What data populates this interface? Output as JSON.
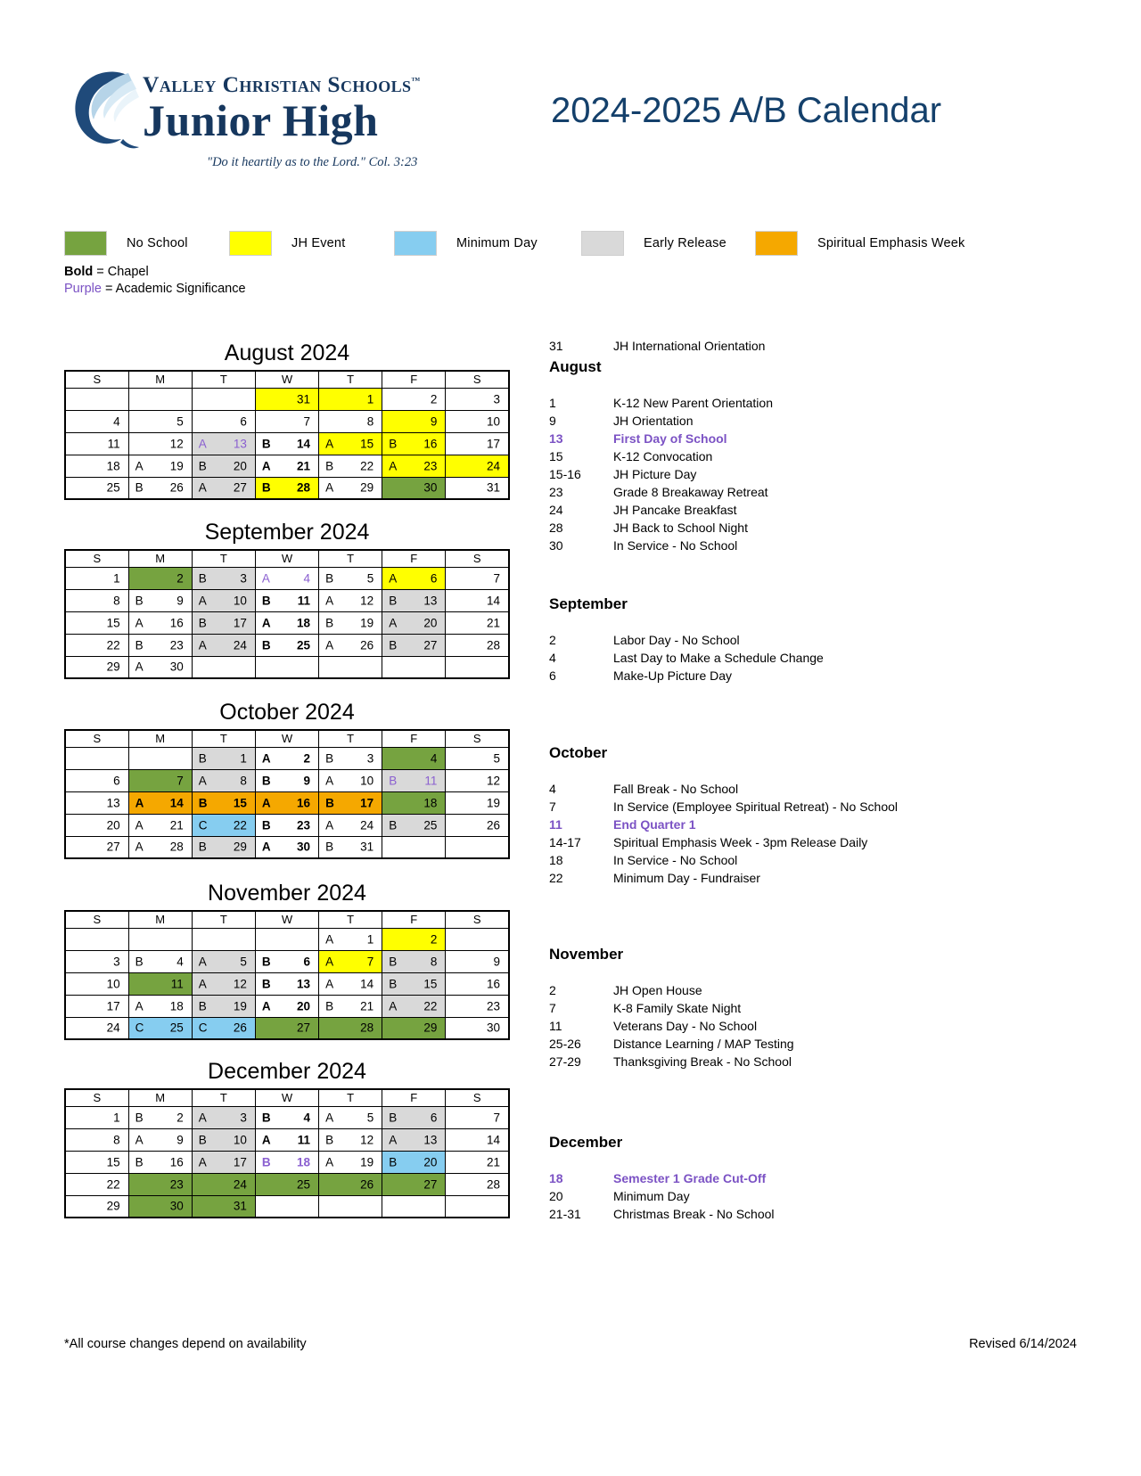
{
  "header": {
    "logo_line1": "Valley Christian Schools",
    "logo_tm": "™",
    "logo_line2": "Junior High",
    "tagline": "\"Do it heartily as to the Lord.\"  Col. 3:23",
    "title": "2024-2025 A/B Calendar"
  },
  "legend": {
    "items": [
      {
        "label": "No School",
        "color": "#76a340"
      },
      {
        "label": "JH Event",
        "color": "#ffff00"
      },
      {
        "label": "Minimum Day",
        "color": "#86cdf0"
      },
      {
        "label": "Early Release",
        "color": "#d9d9d9"
      },
      {
        "label": "Spiritual Emphasis Week",
        "color": "#f5a800"
      }
    ],
    "note_bold": "Bold",
    "note_bold_rest": " = Chapel",
    "note_purple": "Purple",
    "note_purple_rest": " = Academic Significance"
  },
  "weekday_headers": [
    "S",
    "M",
    "T",
    "W",
    "T",
    "F",
    "S"
  ],
  "months": [
    {
      "title": "August 2024",
      "weeks": [
        [
          {},
          {},
          {},
          {
            "num": "31",
            "fill": "jhevent"
          },
          {
            "num": "1",
            "fill": "jhevent"
          },
          {
            "num": "2"
          },
          {
            "num": "3"
          }
        ],
        [
          {
            "num": "4"
          },
          {
            "num": "5"
          },
          {
            "num": "6"
          },
          {
            "num": "7"
          },
          {
            "num": "8"
          },
          {
            "num": "9",
            "fill": "jhevent"
          },
          {
            "num": "10"
          }
        ],
        [
          {
            "num": "11"
          },
          {
            "num": "12"
          },
          {
            "ab": "A",
            "num": "13",
            "fill": "early",
            "acad": true
          },
          {
            "ab": "B",
            "num": "14",
            "chapel": true
          },
          {
            "ab": "A",
            "num": "15",
            "fill": "jhevent"
          },
          {
            "ab": "B",
            "num": "16",
            "fill": "jhevent"
          },
          {
            "num": "17"
          }
        ],
        [
          {
            "num": "18"
          },
          {
            "ab": "A",
            "num": "19"
          },
          {
            "ab": "B",
            "num": "20",
            "fill": "early"
          },
          {
            "ab": "A",
            "num": "21",
            "chapel": true
          },
          {
            "ab": "B",
            "num": "22"
          },
          {
            "ab": "A",
            "num": "23",
            "fill": "jhevent"
          },
          {
            "num": "24",
            "fill": "jhevent"
          }
        ],
        [
          {
            "num": "25"
          },
          {
            "ab": "B",
            "num": "26"
          },
          {
            "ab": "A",
            "num": "27",
            "fill": "early"
          },
          {
            "ab": "B",
            "num": "28",
            "fill": "jhevent",
            "chapel": true
          },
          {
            "ab": "A",
            "num": "29"
          },
          {
            "num": "30",
            "fill": "noschool"
          },
          {
            "num": "31"
          }
        ]
      ]
    },
    {
      "title": "September 2024",
      "weeks": [
        [
          {
            "num": "1"
          },
          {
            "num": "2",
            "fill": "noschool"
          },
          {
            "ab": "B",
            "num": "3",
            "fill": "early"
          },
          {
            "ab": "A",
            "num": "4",
            "acad": true
          },
          {
            "ab": "B",
            "num": "5"
          },
          {
            "ab": "A",
            "num": "6",
            "fill": "jhevent"
          },
          {
            "num": "7"
          }
        ],
        [
          {
            "num": "8"
          },
          {
            "ab": "B",
            "num": "9"
          },
          {
            "ab": "A",
            "num": "10",
            "fill": "early"
          },
          {
            "ab": "B",
            "num": "11",
            "chapel": true
          },
          {
            "ab": "A",
            "num": "12"
          },
          {
            "ab": "B",
            "num": "13",
            "fill": "early"
          },
          {
            "num": "14"
          }
        ],
        [
          {
            "num": "15"
          },
          {
            "ab": "A",
            "num": "16"
          },
          {
            "ab": "B",
            "num": "17",
            "fill": "early"
          },
          {
            "ab": "A",
            "num": "18",
            "chapel": true
          },
          {
            "ab": "B",
            "num": "19"
          },
          {
            "ab": "A",
            "num": "20",
            "fill": "early"
          },
          {
            "num": "21"
          }
        ],
        [
          {
            "num": "22"
          },
          {
            "ab": "B",
            "num": "23"
          },
          {
            "ab": "A",
            "num": "24",
            "fill": "early"
          },
          {
            "ab": "B",
            "num": "25",
            "chapel": true
          },
          {
            "ab": "A",
            "num": "26"
          },
          {
            "ab": "B",
            "num": "27",
            "fill": "early"
          },
          {
            "num": "28"
          }
        ],
        [
          {
            "num": "29"
          },
          {
            "ab": "A",
            "num": "30"
          },
          {},
          {},
          {},
          {},
          {}
        ]
      ]
    },
    {
      "title": "October 2024",
      "weeks": [
        [
          {},
          {},
          {
            "ab": "B",
            "num": "1",
            "fill": "early"
          },
          {
            "ab": "A",
            "num": "2",
            "chapel": true
          },
          {
            "ab": "B",
            "num": "3"
          },
          {
            "num": "4",
            "fill": "noschool"
          },
          {
            "num": "5"
          }
        ],
        [
          {
            "num": "6"
          },
          {
            "num": "7",
            "fill": "noschool"
          },
          {
            "ab": "A",
            "num": "8",
            "fill": "early"
          },
          {
            "ab": "B",
            "num": "9",
            "chapel": true
          },
          {
            "ab": "A",
            "num": "10"
          },
          {
            "ab": "B",
            "num": "11",
            "fill": "early",
            "acad": true
          },
          {
            "num": "12"
          }
        ],
        [
          {
            "num": "13"
          },
          {
            "ab": "A",
            "num": "14",
            "fill": "spirit",
            "chapel": true
          },
          {
            "ab": "B",
            "num": "15",
            "fill": "spirit",
            "chapel": true
          },
          {
            "ab": "A",
            "num": "16",
            "fill": "spirit",
            "chapel": true
          },
          {
            "ab": "B",
            "num": "17",
            "fill": "spirit",
            "chapel": true
          },
          {
            "num": "18",
            "fill": "noschool"
          },
          {
            "num": "19"
          }
        ],
        [
          {
            "num": "20"
          },
          {
            "ab": "A",
            "num": "21"
          },
          {
            "ab": "C",
            "num": "22",
            "fill": "minday"
          },
          {
            "ab": "B",
            "num": "23",
            "chapel": true
          },
          {
            "ab": "A",
            "num": "24"
          },
          {
            "ab": "B",
            "num": "25",
            "fill": "early"
          },
          {
            "num": "26"
          }
        ],
        [
          {
            "num": "27"
          },
          {
            "ab": "A",
            "num": "28"
          },
          {
            "ab": "B",
            "num": "29",
            "fill": "early"
          },
          {
            "ab": "A",
            "num": "30",
            "chapel": true
          },
          {
            "ab": "B",
            "num": "31"
          },
          {},
          {}
        ]
      ]
    },
    {
      "title": "November 2024",
      "weeks": [
        [
          {},
          {},
          {},
          {},
          {
            "ab": "A",
            "num": "1"
          },
          {
            "num": "2",
            "fill": "jhevent"
          },
          {}
        ],
        [
          {
            "num": "3"
          },
          {
            "ab": "B",
            "num": "4"
          },
          {
            "ab": "A",
            "num": "5",
            "fill": "early"
          },
          {
            "ab": "B",
            "num": "6",
            "chapel": true
          },
          {
            "ab": "A",
            "num": "7",
            "fill": "jhevent"
          },
          {
            "ab": "B",
            "num": "8",
            "fill": "early"
          },
          {
            "num": "9"
          }
        ],
        [
          {
            "num": "10"
          },
          {
            "num": "11",
            "fill": "noschool"
          },
          {
            "ab": "A",
            "num": "12",
            "fill": "early"
          },
          {
            "ab": "B",
            "num": "13",
            "chapel": true
          },
          {
            "ab": "A",
            "num": "14"
          },
          {
            "ab": "B",
            "num": "15",
            "fill": "early"
          },
          {
            "num": "16"
          }
        ],
        [
          {
            "num": "17"
          },
          {
            "ab": "A",
            "num": "18"
          },
          {
            "ab": "B",
            "num": "19",
            "fill": "early"
          },
          {
            "ab": "A",
            "num": "20",
            "chapel": true
          },
          {
            "ab": "B",
            "num": "21"
          },
          {
            "ab": "A",
            "num": "22",
            "fill": "early"
          },
          {
            "num": "23"
          }
        ],
        [
          {
            "num": "24"
          },
          {
            "ab": "C",
            "num": "25",
            "fill": "minday"
          },
          {
            "ab": "C",
            "num": "26",
            "fill": "minday"
          },
          {
            "num": "27",
            "fill": "noschool"
          },
          {
            "num": "28",
            "fill": "noschool"
          },
          {
            "num": "29",
            "fill": "noschool"
          },
          {
            "num": "30"
          }
        ]
      ]
    },
    {
      "title": "December 2024",
      "weeks": [
        [
          {
            "num": "1"
          },
          {
            "ab": "B",
            "num": "2"
          },
          {
            "ab": "A",
            "num": "3",
            "fill": "early"
          },
          {
            "ab": "B",
            "num": "4",
            "chapel": true
          },
          {
            "ab": "A",
            "num": "5"
          },
          {
            "ab": "B",
            "num": "6",
            "fill": "early"
          },
          {
            "num": "7"
          }
        ],
        [
          {
            "num": "8"
          },
          {
            "ab": "A",
            "num": "9"
          },
          {
            "ab": "B",
            "num": "10",
            "fill": "early"
          },
          {
            "ab": "A",
            "num": "11",
            "chapel": true
          },
          {
            "ab": "B",
            "num": "12"
          },
          {
            "ab": "A",
            "num": "13",
            "fill": "early"
          },
          {
            "num": "14"
          }
        ],
        [
          {
            "num": "15"
          },
          {
            "ab": "B",
            "num": "16"
          },
          {
            "ab": "A",
            "num": "17",
            "fill": "early"
          },
          {
            "ab": "B",
            "num": "18",
            "acad": true,
            "chapel": true
          },
          {
            "ab": "A",
            "num": "19"
          },
          {
            "ab": "B",
            "num": "20",
            "fill": "minday"
          },
          {
            "num": "21"
          }
        ],
        [
          {
            "num": "22"
          },
          {
            "num": "23",
            "fill": "noschool"
          },
          {
            "num": "24",
            "fill": "noschool"
          },
          {
            "num": "25",
            "fill": "noschool"
          },
          {
            "num": "26",
            "fill": "noschool"
          },
          {
            "num": "27",
            "fill": "noschool"
          },
          {
            "num": "28"
          }
        ],
        [
          {
            "num": "29"
          },
          {
            "num": "30",
            "fill": "noschool"
          },
          {
            "num": "31",
            "fill": "noschool"
          },
          {},
          {},
          {},
          {}
        ]
      ]
    }
  ],
  "events": {
    "preamble": {
      "date": "31",
      "text": "JH International Orientation"
    },
    "groups": [
      {
        "month": "August",
        "rows": [
          {
            "date": "1",
            "text": "K-12 New Parent Orientation"
          },
          {
            "date": "9",
            "text": "JH Orientation"
          },
          {
            "date": "13",
            "text": "First Day of School",
            "acad": true
          },
          {
            "date": "15",
            "text": "K-12 Convocation"
          },
          {
            "date": "15-16",
            "text": "JH Picture Day"
          },
          {
            "date": "23",
            "text": "Grade 8 Breakaway Retreat"
          },
          {
            "date": "24",
            "text": "JH Pancake Breakfast"
          },
          {
            "date": "28",
            "text": "JH Back to School Night"
          },
          {
            "date": "30",
            "text": "In Service - No School"
          }
        ]
      },
      {
        "month": "September",
        "rows": [
          {
            "date": "2",
            "text": "Labor Day - No School"
          },
          {
            "date": "4",
            "text": "Last Day to Make a Schedule Change"
          },
          {
            "date": "6",
            "text": "Make-Up Picture Day"
          }
        ]
      },
      {
        "month": "October",
        "rows": [
          {
            "date": "4",
            "text": "Fall Break - No School"
          },
          {
            "date": "7",
            "text": "In Service (Employee Spiritual Retreat) - No School"
          },
          {
            "date": "11",
            "text": "End Quarter 1",
            "acad": true
          },
          {
            "date": "14-17",
            "text": "Spiritual Emphasis Week - 3pm Release Daily"
          },
          {
            "date": "18",
            "text": "In Service - No School"
          },
          {
            "date": "22",
            "text": "Minimum Day - Fundraiser"
          }
        ]
      },
      {
        "month": "November",
        "rows": [
          {
            "date": "2",
            "text": "JH Open House"
          },
          {
            "date": "7",
            "text": "K-8 Family Skate Night"
          },
          {
            "date": "11",
            "text": "Veterans Day - No School"
          },
          {
            "date": "25-26",
            "text": "Distance Learning / MAP Testing"
          },
          {
            "date": "27-29",
            "text": "Thanksgiving Break - No School"
          }
        ]
      },
      {
        "month": "December",
        "rows": [
          {
            "date": "18",
            "text": "Semester 1 Grade Cut-Off",
            "acad": true
          },
          {
            "date": "20",
            "text": "Minimum Day"
          },
          {
            "date": "21-31",
            "text": "Christmas Break - No School"
          }
        ]
      }
    ]
  },
  "footer": {
    "left": "*All course changes depend on availability",
    "right": "Revised 6/14/2024"
  }
}
